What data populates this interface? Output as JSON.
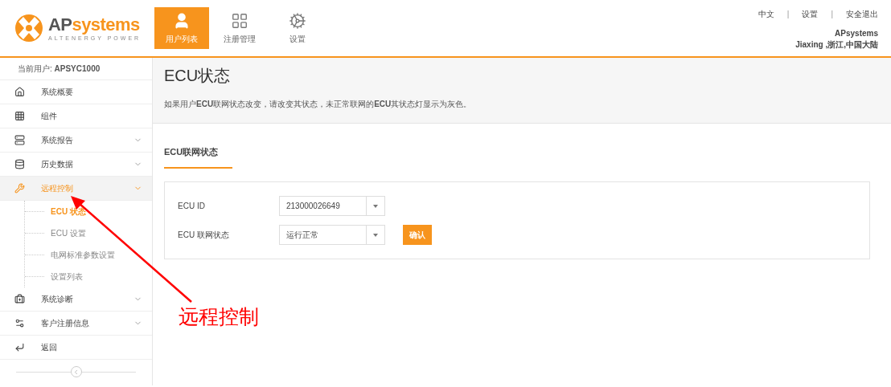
{
  "logo": {
    "text": [
      "AP",
      "systems"
    ],
    "tagline": "ALTENERGY POWER"
  },
  "nav": [
    {
      "label": "用户列表",
      "selected": true
    },
    {
      "label": "注册管理",
      "selected": false
    },
    {
      "label": "设置",
      "selected": false
    }
  ],
  "top_links": [
    "中文",
    "|",
    "设置",
    "|",
    "安全退出"
  ],
  "account": {
    "name": "APsystems",
    "location": "Jiaxing ,浙江,中国大陆"
  },
  "sidebar": {
    "current_user": "当前用户: **APSYC1000**",
    "items": [
      {
        "label": "系统概要",
        "selected": false
      },
      {
        "label": "组件",
        "selected": false
      },
      {
        "label": "系统报告",
        "selected": false,
        "expanded": false
      },
      {
        "label": "历史数据",
        "selected": false,
        "expanded": false
      },
      {
        "label": "远程控制",
        "selected": true,
        "expanded": true,
        "children": [
          {
            "label": "ECU 状态",
            "selected": true
          },
          {
            "label": "ECU 设置",
            "selected": false
          },
          {
            "label": "电网标准参数设置",
            "selected": false
          },
          {
            "label": "设置列表",
            "selected": false
          }
        ]
      },
      {
        "label": "系统诊断",
        "selected": false,
        "expanded": false
      },
      {
        "label": "客户注册信息",
        "selected": false,
        "expanded": false
      },
      {
        "label": "返回",
        "selected": false
      }
    ]
  },
  "page": {
    "title": "ECU状态",
    "description": "如果用户**ECU**联网状态改变，请改变其状态，未正常联网的**ECU**其状态灯显示为灰色。",
    "section_title": "ECU联网状态",
    "fields": [
      {
        "label": "ECU ID",
        "value": "213000026649"
      },
      {
        "label": "ECU 联网状态",
        "value": "运行正常"
      }
    ],
    "button": "确认"
  },
  "annotation": {
    "text": "远程控制"
  }
}
